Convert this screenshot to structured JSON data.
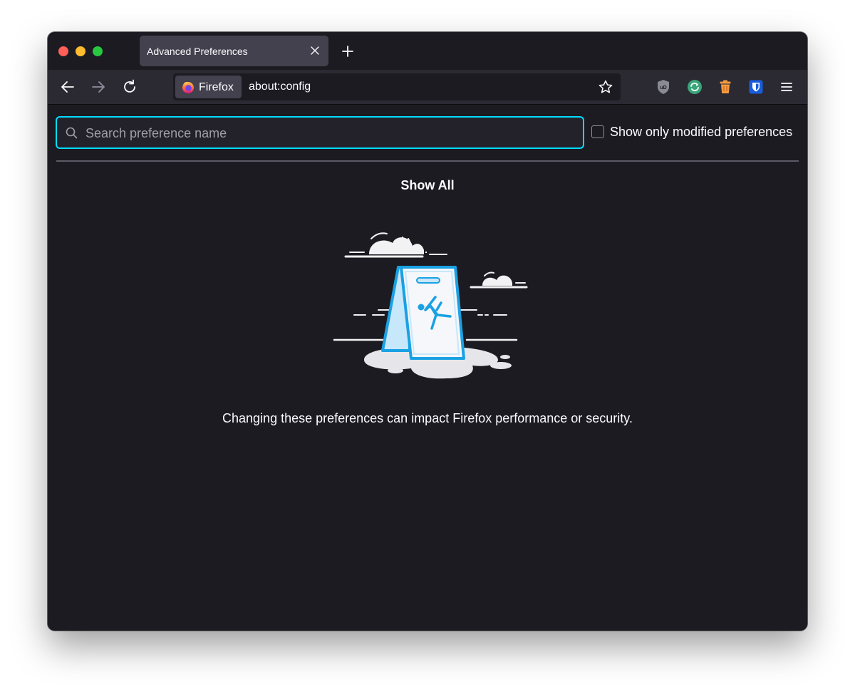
{
  "tabs": [
    {
      "title": "Advanced Preferences",
      "close_icon": "close-icon"
    }
  ],
  "new_tab_icon": "plus-icon",
  "toolbar": {
    "identity_label": "Firefox",
    "url": "about:config",
    "icons": [
      "back-arrow-icon",
      "forward-arrow-icon",
      "reload-icon",
      "star-icon",
      "shield-icon",
      "sync-icon",
      "trash-icon",
      "bitwarden-icon",
      "hamburger-menu-icon"
    ]
  },
  "config": {
    "search_placeholder": "Search preference name",
    "checkbox_label": "Show only modified preferences",
    "checkbox_checked": false,
    "show_all": "Show All",
    "warning_text": "Changing these preferences can impact Firefox performance or security."
  },
  "colors": {
    "window_bg": "#1c1b22",
    "toolbar_bg": "#2b2a33",
    "tab_selected": "#42414d",
    "focus_accent": "#00ddff",
    "illustration_blue": "#1aa1e3"
  }
}
